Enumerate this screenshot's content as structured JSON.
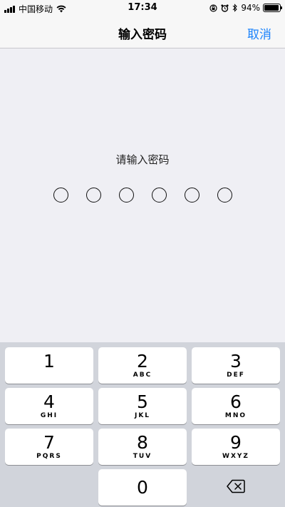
{
  "status_bar": {
    "carrier": "中国移动",
    "time": "17:34",
    "battery_percent": "94%",
    "battery_level": 0.94,
    "icons": [
      "signal-icon",
      "wifi-icon",
      "orientation-lock-icon",
      "alarm-icon",
      "bluetooth-icon",
      "battery-icon"
    ]
  },
  "nav": {
    "title": "输入密码",
    "cancel_label": "取消"
  },
  "main": {
    "prompt": "请输入密码",
    "passcode_length": 6
  },
  "keypad": {
    "keys": [
      {
        "digit": "1",
        "letters": ""
      },
      {
        "digit": "2",
        "letters": "ABC"
      },
      {
        "digit": "3",
        "letters": "DEF"
      },
      {
        "digit": "4",
        "letters": "GHI"
      },
      {
        "digit": "5",
        "letters": "JKL"
      },
      {
        "digit": "6",
        "letters": "MNO"
      },
      {
        "digit": "7",
        "letters": "PQRS"
      },
      {
        "digit": "8",
        "letters": "TUV"
      },
      {
        "digit": "9",
        "letters": "WXYZ"
      },
      {
        "digit": "0",
        "letters": ""
      }
    ],
    "delete_icon": "backspace-icon"
  },
  "colors": {
    "accent": "#1a82fb",
    "background": "#efeff4",
    "keypad_background": "#d1d4db"
  }
}
